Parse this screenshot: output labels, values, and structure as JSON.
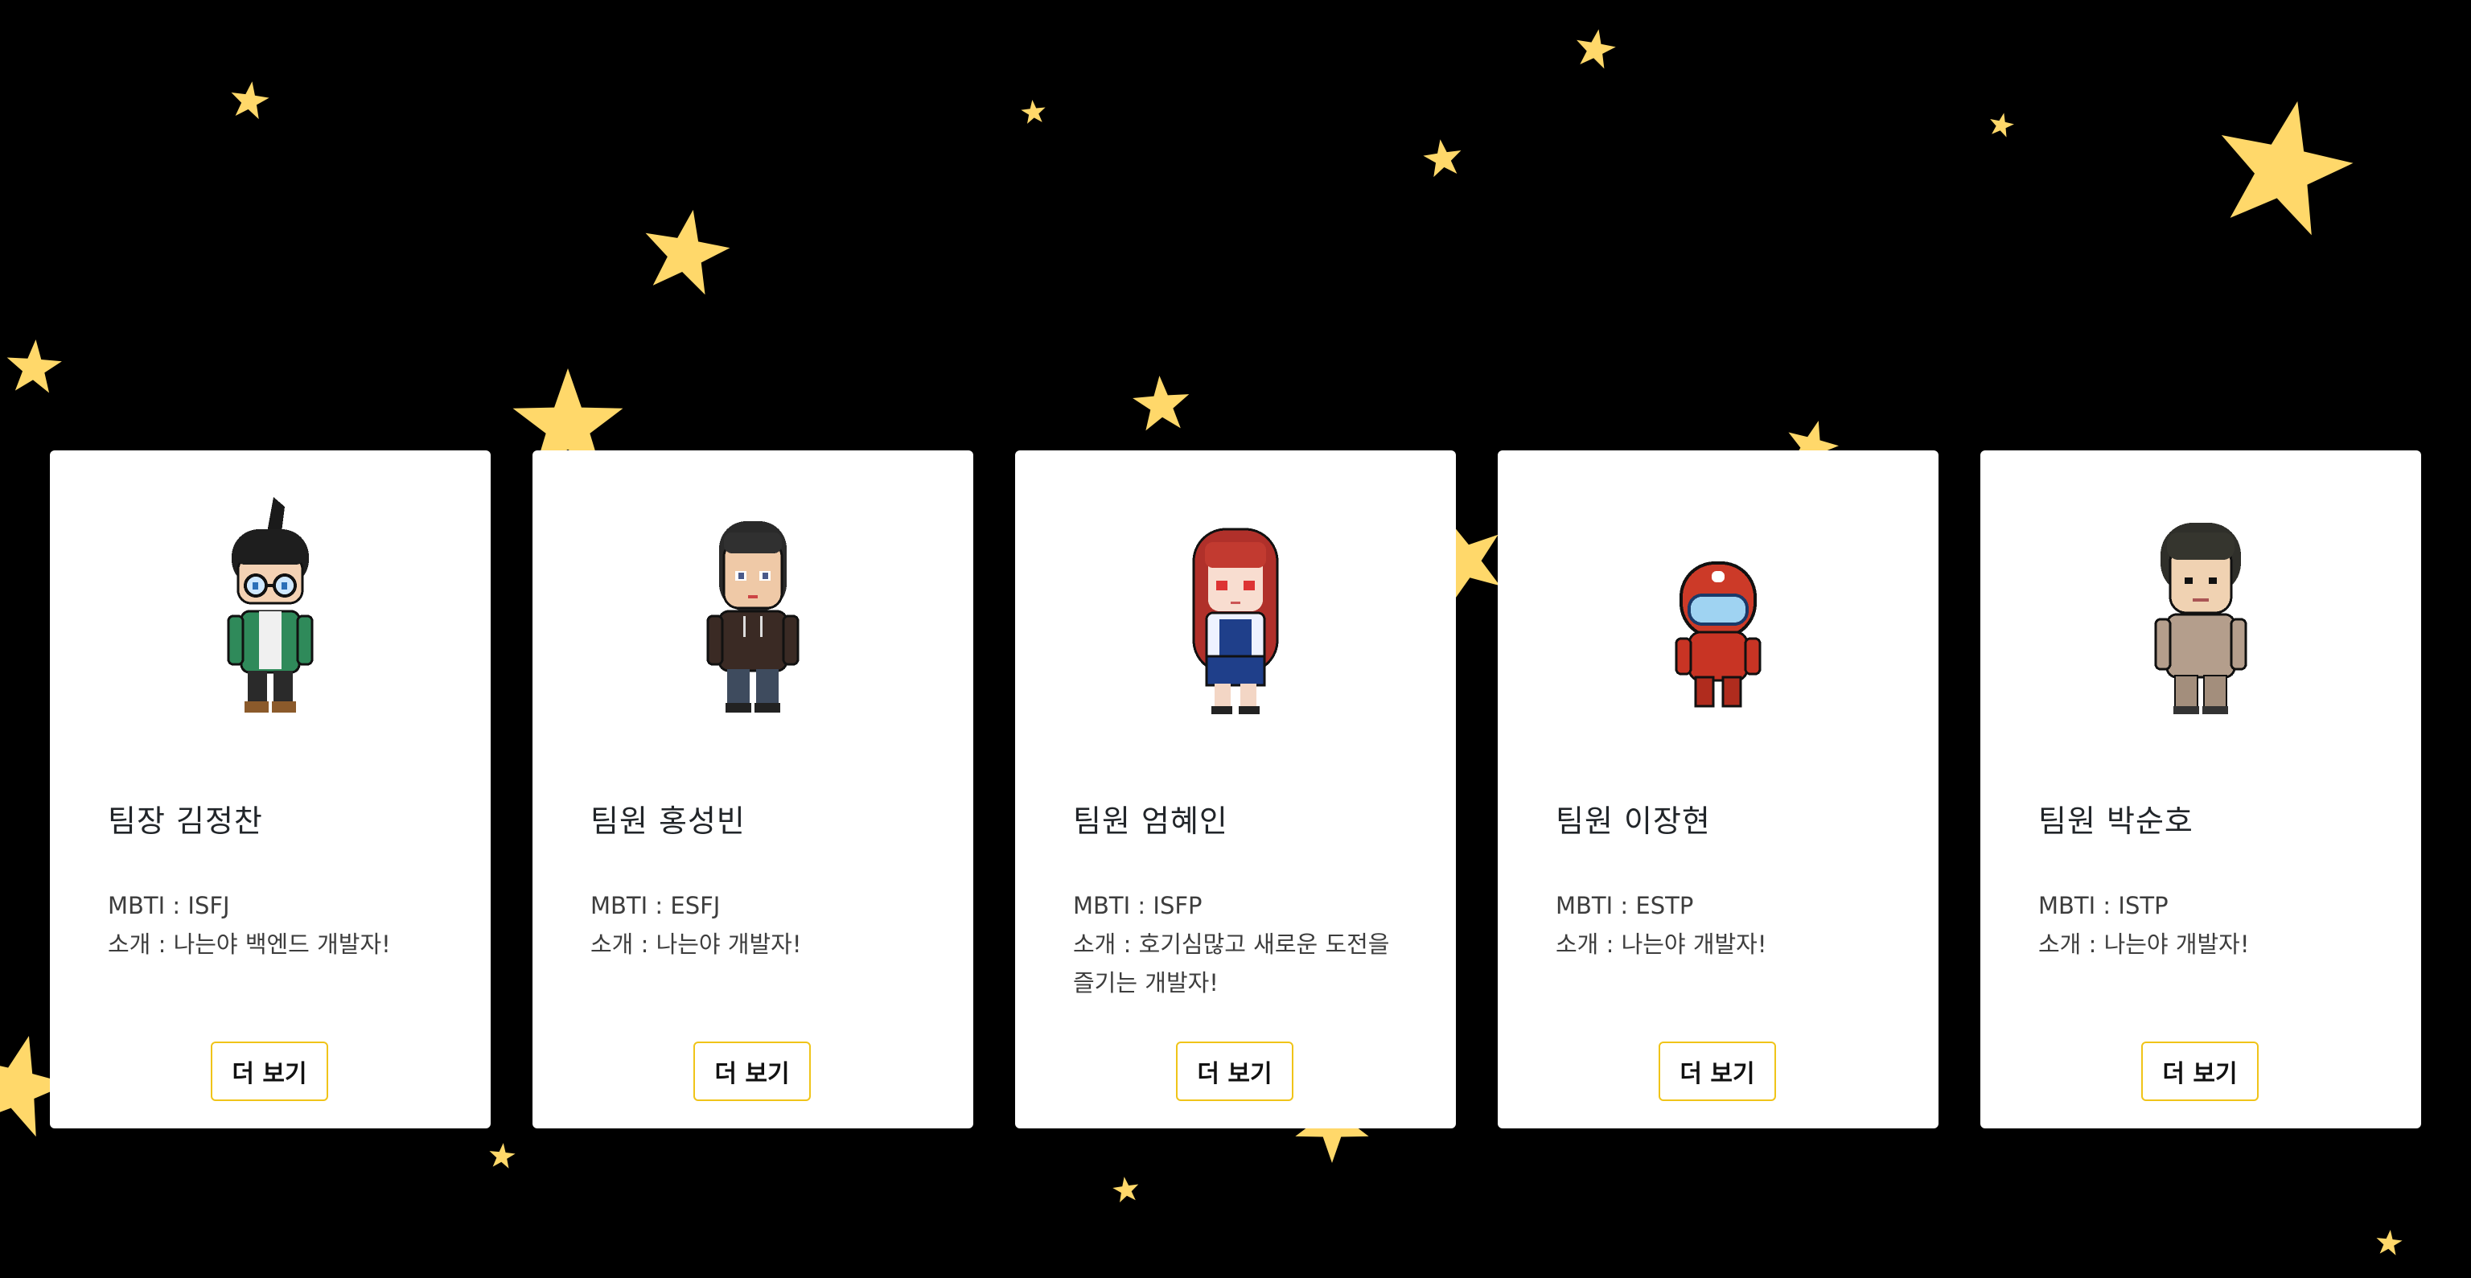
{
  "colors": {
    "background": "#000000",
    "star": "#ffd86a",
    "card": "#ffffff",
    "button_border": "#f0c419"
  },
  "members": [
    {
      "name": "팀장 김정찬",
      "mbti": "MBTI : ISFJ",
      "intro": "소개 : 나는야 백엔드 개발자!",
      "button": "더 보기",
      "avatar": "pixel-avatar-glasses-green-jacket"
    },
    {
      "name": "팀원 홍성빈",
      "mbti": "MBTI : ESFJ",
      "intro": "소개 : 나는야 개발자!",
      "button": "더 보기",
      "avatar": "pixel-avatar-brown-hoodie"
    },
    {
      "name": "팀원 엄혜인",
      "mbti": "MBTI : ISFP",
      "intro": "소개 : 호기심많고 새로운 도전을 즐기는 개발자!",
      "button": "더 보기",
      "avatar": "pixel-avatar-red-hair-school-uniform"
    },
    {
      "name": "팀원 이장현",
      "mbti": "MBTI : ESTP",
      "intro": "소개 : 나는야 개발자!",
      "button": "더 보기",
      "avatar": "pixel-avatar-red-crewmate"
    },
    {
      "name": "팀원 박순호",
      "mbti": "MBTI : ISTP",
      "intro": "소개 : 나는야 개발자!",
      "button": "더 보기",
      "avatar": "pixel-avatar-beige-sweater"
    }
  ]
}
